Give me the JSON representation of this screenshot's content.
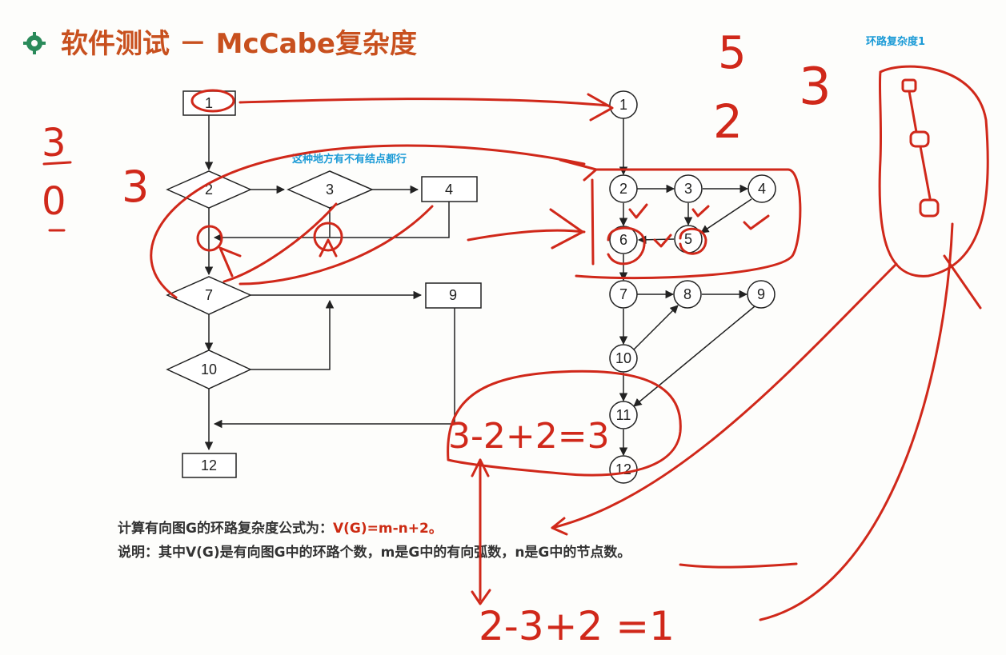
{
  "slide": {
    "title": "软件测试  －  McCabe复杂度",
    "title_color": "#c8501e",
    "bullet_icon": "gear-icon"
  },
  "notes": {
    "question": "这种地方有不有结点都行",
    "loop_label": "环路复杂度1"
  },
  "flowchart": {
    "nodes": [
      {
        "id": "1",
        "label": "1",
        "shape": "rect"
      },
      {
        "id": "2",
        "label": "2",
        "shape": "diamond"
      },
      {
        "id": "3",
        "label": "3",
        "shape": "diamond"
      },
      {
        "id": "4",
        "label": "4",
        "shape": "rect"
      },
      {
        "id": "7",
        "label": "7",
        "shape": "diamond"
      },
      {
        "id": "9",
        "label": "9",
        "shape": "rect"
      },
      {
        "id": "10",
        "label": "10",
        "shape": "diamond"
      },
      {
        "id": "12",
        "label": "12",
        "shape": "rect"
      }
    ]
  },
  "flowgraph": {
    "nodes": [
      "1",
      "2",
      "3",
      "4",
      "5",
      "6",
      "7",
      "8",
      "9",
      "10",
      "11",
      "12"
    ],
    "edges": [
      [
        "1",
        "2"
      ],
      [
        "2",
        "3"
      ],
      [
        "3",
        "4"
      ],
      [
        "2",
        "6"
      ],
      [
        "3",
        "5"
      ],
      [
        "4",
        "5"
      ],
      [
        "5",
        "6"
      ],
      [
        "6",
        "7"
      ],
      [
        "7",
        "8"
      ],
      [
        "8",
        "9"
      ],
      [
        "7",
        "10"
      ],
      [
        "10",
        "8"
      ],
      [
        "10",
        "11"
      ],
      [
        "9",
        "11"
      ],
      [
        "11",
        "12"
      ]
    ]
  },
  "formula": {
    "line1_prefix": "计算有向图",
    "line1_g": "G",
    "line1_mid": "的环路复杂度公式为：",
    "line1_formula": "V(G)=m-n+2",
    "line1_end": "。",
    "line2_a": "说明：其中",
    "line2_vg": "V(G)",
    "line2_b": "是有向图",
    "line2_g": "G",
    "line2_c": "中的环路个数，",
    "line2_m": "m",
    "line2_d": "是",
    "line2_g2": "G",
    "line2_e": "中的有向弧数，",
    "line2_n": "n",
    "line2_f": "是",
    "line2_g3": "G",
    "line2_h": "中的节点数。"
  },
  "handwriting": {
    "top_left_num_a": "3",
    "top_left_num_b": "0",
    "top_left_num_c": "3",
    "top_right_a": "5",
    "top_right_b": "2",
    "top_right_c": "3",
    "calc_upper": "3-2+2=3",
    "calc_lower": "2-3+2 =1"
  }
}
